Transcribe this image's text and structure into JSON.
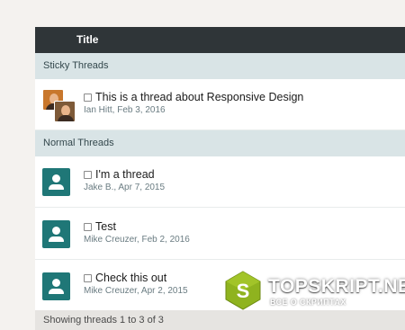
{
  "table": {
    "header_title": "Title",
    "sections": {
      "sticky": "Sticky Threads",
      "normal": "Normal Threads"
    },
    "sticky_threads": [
      {
        "title": "This is a thread about Responsive Design",
        "meta": "Ian Hitt, Feb 3, 2016",
        "avatar": "user-photos"
      }
    ],
    "normal_threads": [
      {
        "title": "I'm a thread",
        "meta": "Jake B., Apr 7, 2015",
        "avatar": "user-placeholder-icon"
      },
      {
        "title": "Test",
        "meta": "Mike Creuzer, Feb 2, 2016",
        "avatar": "user-placeholder-icon"
      },
      {
        "title": "Check this out",
        "meta": "Mike Creuzer, Apr 2, 2015",
        "avatar": "user-placeholder-icon"
      }
    ],
    "footer": "Showing threads 1 to 3 of 3"
  },
  "watermark": {
    "logo_letter": "S",
    "title": "TOPSKRIPT.NET",
    "subtitle": "ВСЕ О СКРИПТАХ"
  },
  "colors": {
    "header_bg": "#2f3538",
    "section_bg": "#d9e4e6",
    "avatar_bg": "#1f7777",
    "page_bg": "#f4f2ef",
    "logo_green": "#8fb31f"
  }
}
